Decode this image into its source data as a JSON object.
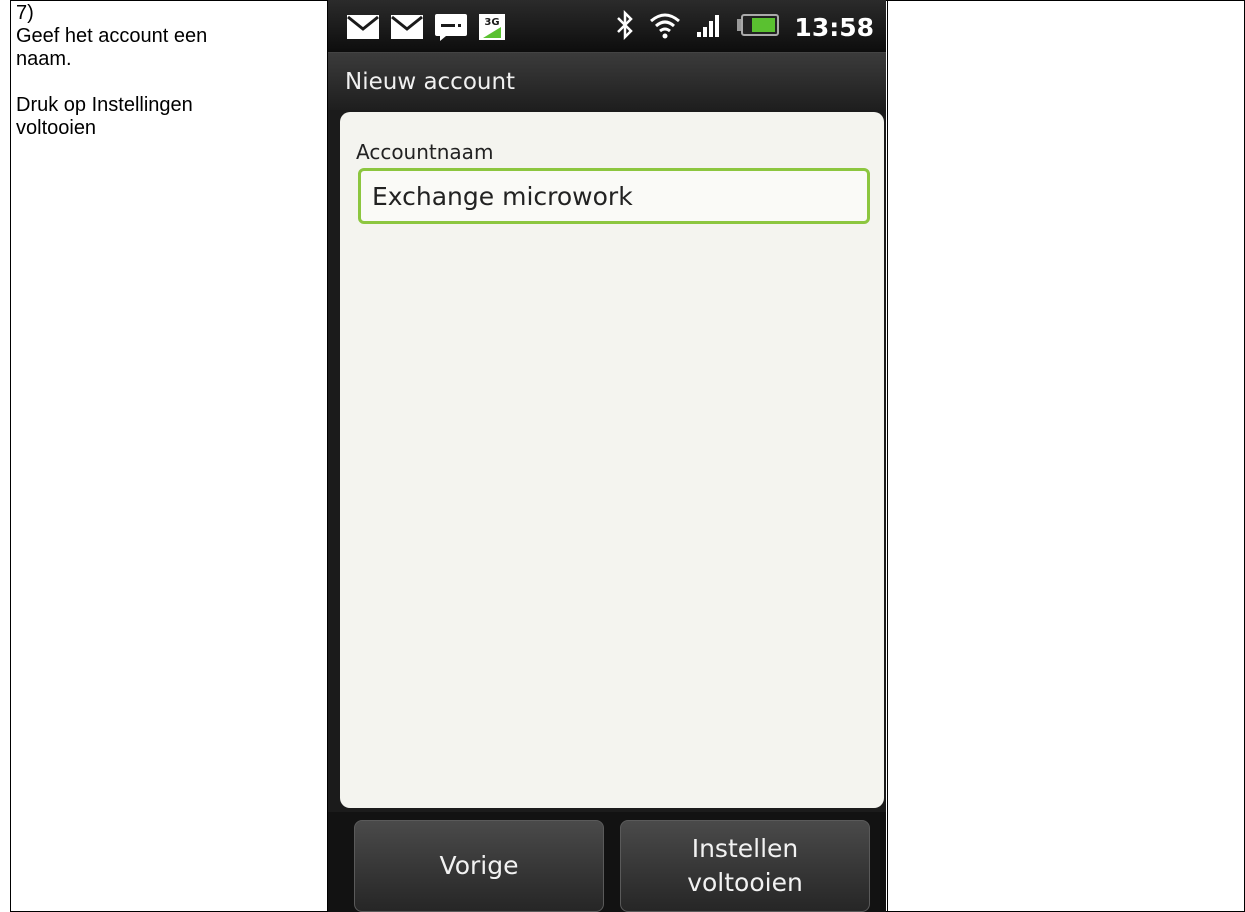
{
  "instructions": {
    "step": "7)",
    "line1": "Geef het account een",
    "line2": "naam.",
    "line3": "Druk op Instellingen",
    "line4": "voltooien"
  },
  "phone": {
    "status_bar": {
      "time": "13:58",
      "network_badge": "3G",
      "left_icons": [
        "mail-icon",
        "mail-icon",
        "message-icon",
        "3g-icon"
      ],
      "right_icons": [
        "bluetooth-icon",
        "wifi-icon",
        "signal-icon",
        "battery-icon"
      ]
    },
    "title": "Nieuw account",
    "field": {
      "label": "Accountnaam",
      "value": "Exchange microwork"
    },
    "buttons": {
      "previous": "Vorige",
      "finish_line1": "Instellen",
      "finish_line2": "voltooien"
    },
    "colors": {
      "accent": "#8cc63f",
      "battery": "#5ac130"
    }
  }
}
